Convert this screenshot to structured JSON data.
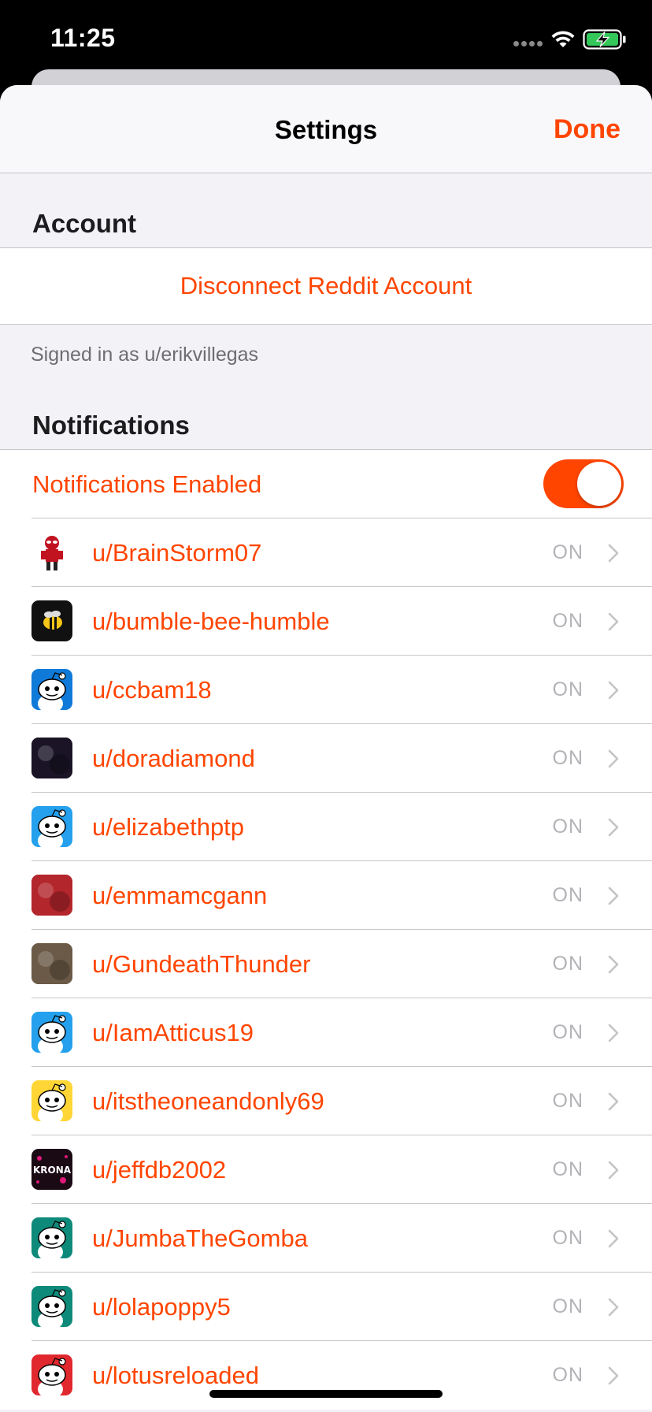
{
  "status_bar": {
    "time": "11:25",
    "icons": [
      "signal-dots-icon",
      "wifi-icon",
      "battery-charging-icon"
    ]
  },
  "nav": {
    "title": "Settings",
    "done_label": "Done"
  },
  "account": {
    "header": "Account",
    "disconnect_label": "Disconnect Reddit Account",
    "signed_in_text": "Signed in as u/erikvillegas"
  },
  "notifications": {
    "header": "Notifications",
    "enabled_label": "Notifications Enabled",
    "enabled": true,
    "users": [
      {
        "name": "u/BrainStorm07",
        "status": "ON",
        "avatar_color": "#ffffff",
        "avatar": "deadpool-icon"
      },
      {
        "name": "u/bumble-bee-humble",
        "status": "ON",
        "avatar_color": "#111111",
        "avatar": "bee-icon"
      },
      {
        "name": "u/ccbam18",
        "status": "ON",
        "avatar_color": "#0f7ad8",
        "avatar": "snoo-icon"
      },
      {
        "name": "u/doradiamond",
        "status": "ON",
        "avatar_color": "#1a1426",
        "avatar": "photo-icon"
      },
      {
        "name": "u/elizabethptp",
        "status": "ON",
        "avatar_color": "#24a0ed",
        "avatar": "snoo-icon"
      },
      {
        "name": "u/emmamcgann",
        "status": "ON",
        "avatar_color": "#b3262c",
        "avatar": "photo-icon"
      },
      {
        "name": "u/GundeathThunder",
        "status": "ON",
        "avatar_color": "#6b5a47",
        "avatar": "photo-icon"
      },
      {
        "name": "u/IamAtticus19",
        "status": "ON",
        "avatar_color": "#24a0ed",
        "avatar": "snoo-icon"
      },
      {
        "name": "u/itstheoneandonly69",
        "status": "ON",
        "avatar_color": "#ffd635",
        "avatar": "snoo-icon"
      },
      {
        "name": "u/jeffdb2002",
        "status": "ON",
        "avatar_color": "#1a0a14",
        "avatar": "krona-logo-icon"
      },
      {
        "name": "u/JumbaTheGomba",
        "status": "ON",
        "avatar_color": "#0e8a7a",
        "avatar": "snoo-icon"
      },
      {
        "name": "u/lolapoppy5",
        "status": "ON",
        "avatar_color": "#0e8a7a",
        "avatar": "snoo-icon"
      },
      {
        "name": "u/lotusreloaded",
        "status": "ON",
        "avatar_color": "#e0282e",
        "avatar": "snoo-icon"
      }
    ]
  },
  "colors": {
    "accent": "#ff4500",
    "background": "#f2f2f7",
    "status_text": "#b3b3b8"
  }
}
